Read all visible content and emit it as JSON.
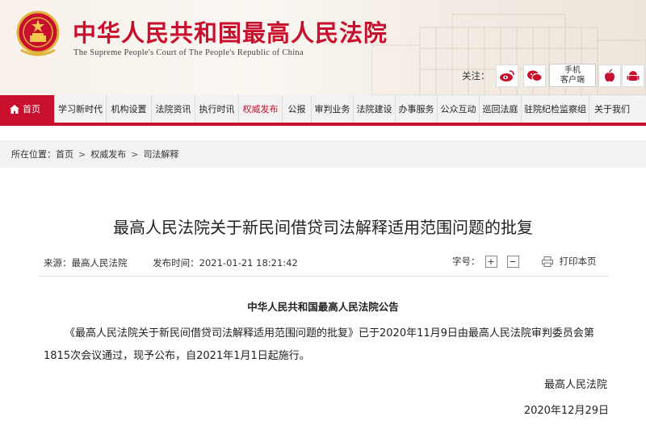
{
  "header": {
    "title": "中华人民共和国最高人民法院",
    "subtitle": "The Supreme People's Court of The People's Republic of China",
    "follow_label": "关注：",
    "mobile_line1": "手机",
    "mobile_line2": "客户端",
    "brand_color": "#c8102e"
  },
  "nav": {
    "items": [
      {
        "label": "首页"
      },
      {
        "label": "学习新时代"
      },
      {
        "label": "机构设置"
      },
      {
        "label": "法院资讯"
      },
      {
        "label": "执行时讯"
      },
      {
        "label": "权威发布"
      },
      {
        "label": "公报"
      },
      {
        "label": "审判业务"
      },
      {
        "label": "法院建设"
      },
      {
        "label": "办事服务"
      },
      {
        "label": "公众互动"
      },
      {
        "label": "巡回法庭"
      },
      {
        "label": "驻院纪检监察组"
      },
      {
        "label": "关于我们"
      }
    ]
  },
  "breadcrumb": {
    "prefix": "所在位置：",
    "items": [
      "首页",
      "权威发布",
      "司法解释"
    ],
    "separator": ">"
  },
  "article": {
    "title": "最高人民法院关于新民间借贷司法解释适用范围问题的批复",
    "source_label": "来源：",
    "source_value": "最高人民法院",
    "date_label": "发布时间：",
    "date_value": "2021-01-21 18:21:42",
    "font_label": "字号：",
    "font_plus": "+",
    "font_minus": "−",
    "print_label": "打印本页",
    "notice_heading": "中华人民共和国最高人民法院公告",
    "body": "《最高人民法院关于新民间借贷司法解释适用范围问题的批复》已于2020年11月9日由最高人民法院审判委员会第1815次会议通过，现予公布，自2021年1月1日起施行。",
    "signature_org": "最高人民法院",
    "signature_date": "2020年12月29日"
  }
}
